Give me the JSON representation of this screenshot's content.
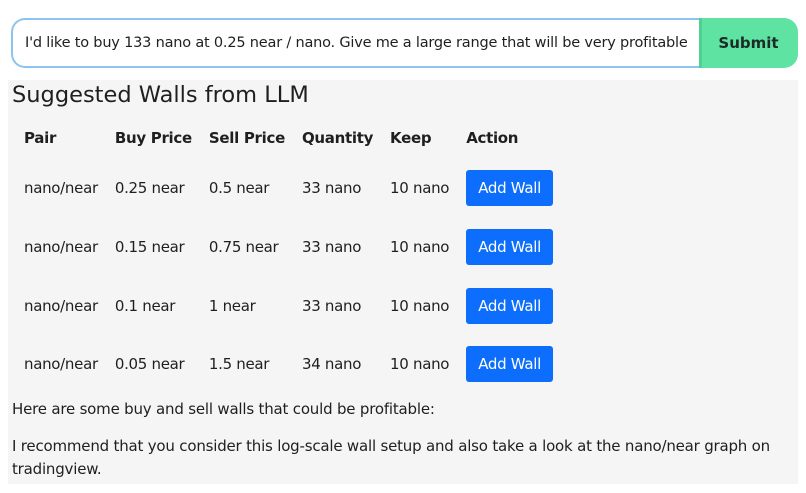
{
  "prompt": {
    "value": "I'd like to buy 133 nano at 0.25 near / nano. Give me a large range that will be very profitable.",
    "submit_label": "Submit"
  },
  "panel": {
    "title": "Suggested Walls from LLM",
    "columns": [
      "Pair",
      "Buy Price",
      "Sell Price",
      "Quantity",
      "Keep",
      "Action"
    ],
    "rows": [
      {
        "pair": "nano/near",
        "buy_price": "0.25 near",
        "sell_price": "0.5 near",
        "quantity": "33 nano",
        "keep": "10 nano",
        "action": "Add Wall"
      },
      {
        "pair": "nano/near",
        "buy_price": "0.15 near",
        "sell_price": "0.75 near",
        "quantity": "33 nano",
        "keep": "10 nano",
        "action": "Add Wall"
      },
      {
        "pair": "nano/near",
        "buy_price": "0.1 near",
        "sell_price": "1 near",
        "quantity": "33 nano",
        "keep": "10 nano",
        "action": "Add Wall"
      },
      {
        "pair": "nano/near",
        "buy_price": "0.05 near",
        "sell_price": "1.5 near",
        "quantity": "34 nano",
        "keep": "10 nano",
        "action": "Add Wall"
      }
    ],
    "summary": "Here are some buy and sell walls that could be profitable:",
    "recommendation": "I recommend that you consider this log-scale wall setup and also take a look at the nano/near graph on tradingview."
  },
  "colors": {
    "submit_bg": "#5ee3a3",
    "input_border": "#8ec3f0",
    "add_wall_bg": "#0d6efd",
    "panel_bg": "#f5f5f5"
  }
}
